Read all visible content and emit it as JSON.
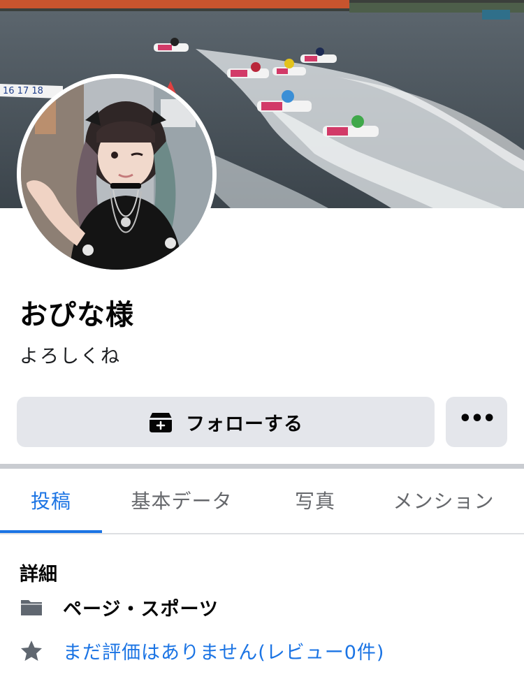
{
  "profile": {
    "name": "おぴな様",
    "bio": "よろしくね"
  },
  "actions": {
    "follow_label": "フォローする",
    "more_label": "•••"
  },
  "tabs": [
    {
      "label": "投稿",
      "active": true
    },
    {
      "label": "基本データ",
      "active": false
    },
    {
      "label": "写真",
      "active": false
    },
    {
      "label": "メンション",
      "active": false
    }
  ],
  "details": {
    "title": "詳細",
    "category": "ページ・スポーツ",
    "rating": "まだ評価はありません(レビュー0件)"
  },
  "cover": {
    "banner_numbers": "16 17 18"
  },
  "colors": {
    "accent": "#1b74e4",
    "button_bg": "#e4e6eb",
    "divider": "#c9ccd1"
  }
}
